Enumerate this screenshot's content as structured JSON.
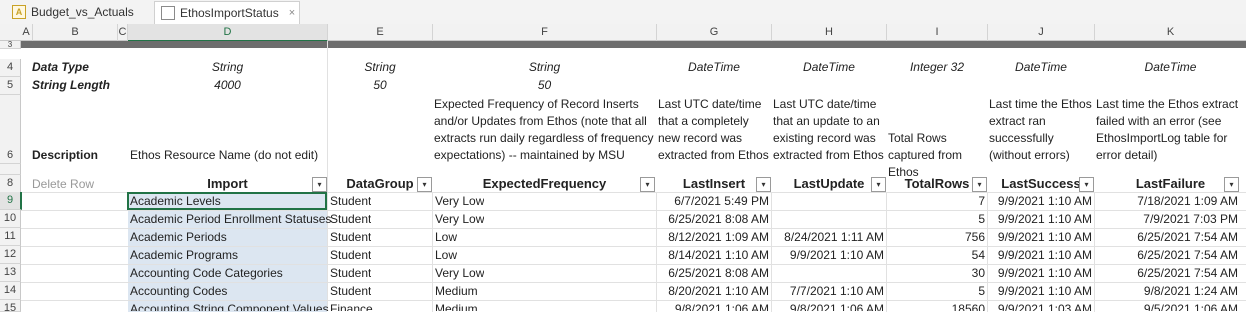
{
  "tabs": [
    {
      "icon": "A",
      "label": "Budget_vs_Actuals"
    },
    {
      "label": "EthosImportStatus",
      "close": "×"
    }
  ],
  "columns": [
    "A",
    "B",
    "C",
    "D",
    "E",
    "F",
    "G",
    "H",
    "I",
    "J",
    "K"
  ],
  "rows": {
    "r4": {
      "num": "4",
      "label": "Data Type",
      "D": "String",
      "E": "String",
      "F": "String",
      "G": "DateTime",
      "H": "DateTime",
      "I": "Integer 32",
      "J": "DateTime",
      "K": "DateTime"
    },
    "r5": {
      "num": "5",
      "label": "String Length",
      "D": "4000",
      "E": "50",
      "F": "50"
    },
    "r6": {
      "num": "6",
      "label": "Description",
      "D": "Ethos Resource Name (do not edit)",
      "F": "Expected Frequency of Record Inserts and/or Updates from Ethos (note that all extracts run daily regardless of frequency expectations) -- maintained by MSU",
      "G": "Last UTC date/time that a completely new record was extracted from Ethos",
      "H": "Last UTC date/time that an update to an existing record was extracted from Ethos",
      "I": "Total Rows captured from Ethos",
      "J": "Last time the Ethos extract ran successfully (without errors)",
      "K": "Last time the Ethos extract failed with an error (see EthosImportLog table for error detail)"
    },
    "r8": {
      "num": "8",
      "B": "Delete Row",
      "D": "Import",
      "E": "DataGroup",
      "F": "ExpectedFrequency",
      "G": "LastInsert",
      "H": "LastUpdate",
      "I": "TotalRows",
      "J": "LastSuccess",
      "K": "LastFailure"
    },
    "r3": {
      "num": "3"
    }
  },
  "table": [
    {
      "num": "9",
      "import": "Academic Levels",
      "group": "Student",
      "freq": "Very Low",
      "insert": "6/7/2021 5:49 PM",
      "update": "",
      "total": "7",
      "success": "9/9/2021 1:10 AM",
      "failure": "7/18/2021 1:09 AM"
    },
    {
      "num": "10",
      "import": "Academic Period Enrollment Statuses",
      "group": "Student",
      "freq": "Very Low",
      "insert": "6/25/2021 8:08 AM",
      "update": "",
      "total": "5",
      "success": "9/9/2021 1:10 AM",
      "failure": "7/9/2021 7:03 PM"
    },
    {
      "num": "11",
      "import": "Academic Periods",
      "group": "Student",
      "freq": "Low",
      "insert": "8/12/2021 1:09 AM",
      "update": "8/24/2021 1:11 AM",
      "total": "756",
      "success": "9/9/2021 1:10 AM",
      "failure": "6/25/2021 7:54 AM"
    },
    {
      "num": "12",
      "import": "Academic Programs",
      "group": "Student",
      "freq": "Low",
      "insert": "8/14/2021 1:10 AM",
      "update": "9/9/2021 1:10 AM",
      "total": "54",
      "success": "9/9/2021 1:10 AM",
      "failure": "6/25/2021 7:54 AM"
    },
    {
      "num": "13",
      "import": "Accounting Code Categories",
      "group": "Student",
      "freq": "Very Low",
      "insert": "6/25/2021 8:08 AM",
      "update": "",
      "total": "30",
      "success": "9/9/2021 1:10 AM",
      "failure": "6/25/2021 7:54 AM"
    },
    {
      "num": "14",
      "import": "Accounting Codes",
      "group": "Student",
      "freq": "Medium",
      "insert": "8/20/2021 1:10 AM",
      "update": "7/7/2021 1:10 AM",
      "total": "5",
      "success": "9/9/2021 1:10 AM",
      "failure": "9/8/2021 1:24 AM"
    },
    {
      "num": "15",
      "import": "Accounting String Component Values",
      "group": "Finance",
      "freq": "Medium",
      "insert": "9/8/2021 1:06 AM",
      "update": "9/8/2021 1:06 AM",
      "total": "18560",
      "success": "9/9/2021 1:03 AM",
      "failure": "9/5/2021 1:06 AM"
    }
  ],
  "dropdown_glyph": "▾"
}
